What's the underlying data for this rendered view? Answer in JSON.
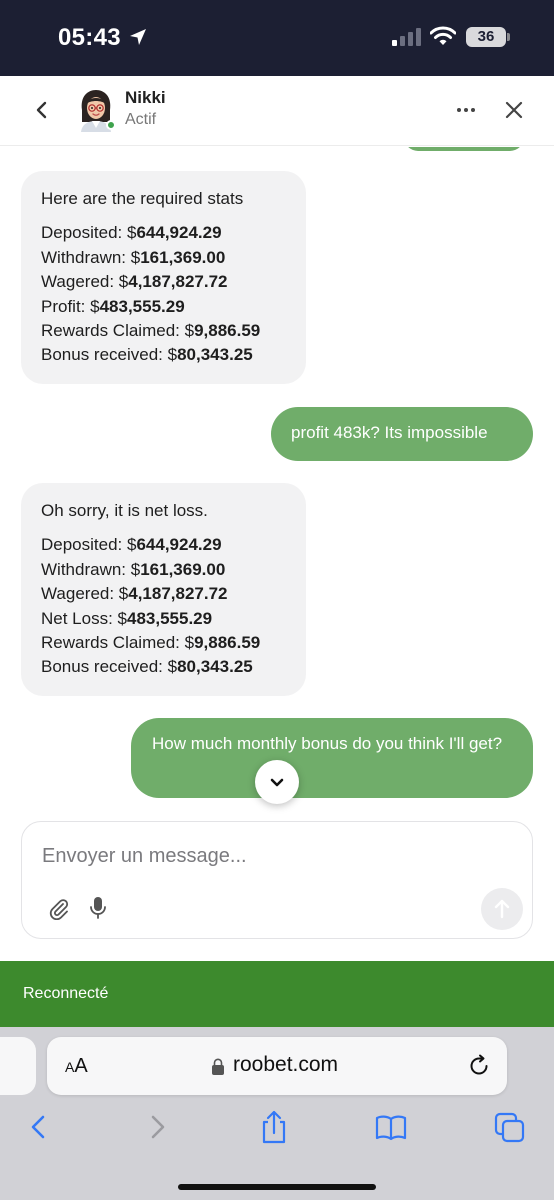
{
  "status_bar": {
    "time": "05:43",
    "battery": "36"
  },
  "header": {
    "name": "Nikki",
    "status": "Actif"
  },
  "messages": {
    "m1": {
      "intro": "Here are the required stats",
      "lines": [
        {
          "label": "Deposited: $",
          "value": "644,924.29"
        },
        {
          "label": "Withdrawn: $",
          "value": "161,369.00"
        },
        {
          "label": "Wagered: $",
          "value": "4,187,827.72"
        },
        {
          "label": "Profit: $",
          "value": "483,555.29"
        },
        {
          "label": "Rewards Claimed: $",
          "value": "9,886.59"
        },
        {
          "label": "Bonus received: $",
          "value": "80,343.25"
        }
      ]
    },
    "m2": {
      "text": "profit 483k? Its impossible"
    },
    "m3": {
      "intro": "Oh sorry, it is net loss.",
      "lines": [
        {
          "label": "Deposited: $",
          "value": "644,924.29"
        },
        {
          "label": "Withdrawn: $",
          "value": "161,369.00"
        },
        {
          "label": "Wagered: $",
          "value": "4,187,827.72"
        },
        {
          "label": "Net Loss: $",
          "value": "483,555.29"
        },
        {
          "label": "Rewards Claimed: $",
          "value": "9,886.59"
        },
        {
          "label": "Bonus received: $",
          "value": "80,343.25"
        }
      ]
    },
    "m4": {
      "text": "How much monthly bonus do you think I'll get?"
    }
  },
  "composer": {
    "placeholder": "Envoyer un message..."
  },
  "banner": {
    "text": "Reconnecté"
  },
  "browser": {
    "aa_small": "A",
    "aa_large": "A",
    "url": "roobet.com"
  },
  "colors": {
    "status_bar": "#1c1f33",
    "outgoing_bubble": "#70ad6a",
    "incoming_bubble": "#f2f2f3",
    "banner": "#3d8a2d",
    "ios_blue": "#3478f6"
  }
}
